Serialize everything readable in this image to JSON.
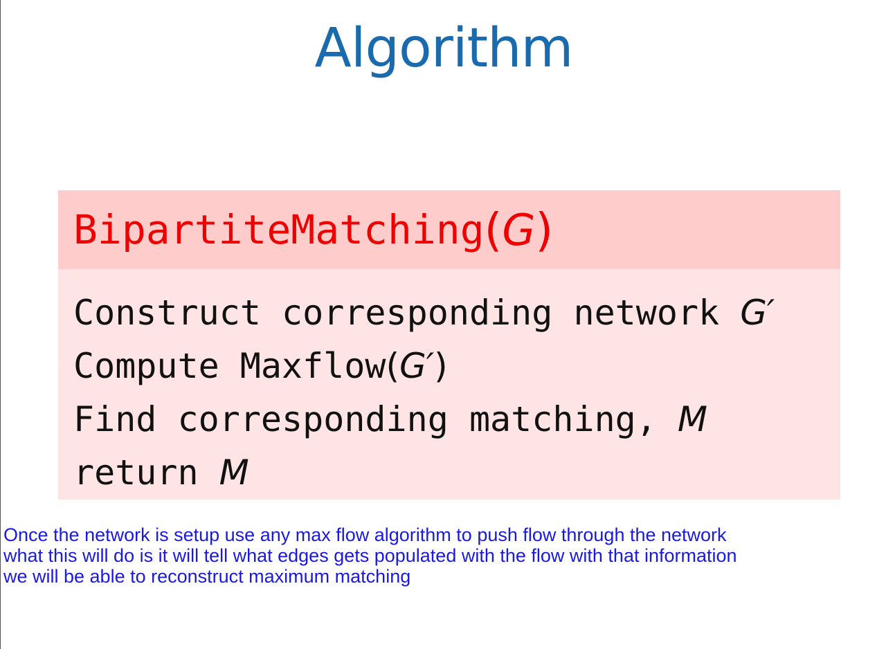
{
  "slide": {
    "title": "Algorithm"
  },
  "algorithm": {
    "header": {
      "name": "BipartiteMatching",
      "open_paren": "(",
      "argument": "G",
      "close_paren": ")"
    },
    "lines": [
      {
        "text": "Construct corresponding network",
        "math": "G′"
      },
      {
        "prefix": "Compute",
        "function": "Maxflow",
        "open_paren": "(",
        "math": "G′",
        "close_paren": ")"
      },
      {
        "text": "Find corresponding matching,",
        "math": "M"
      },
      {
        "text": "return",
        "math": "M"
      }
    ]
  },
  "notes": {
    "lines": [
      "Once the network is setup use any max flow algorithm to push flow through the network",
      "what this will do is it will tell what edges gets populated with the flow with that information",
      "we will be able to reconstruct maximum matching"
    ]
  },
  "colors": {
    "title": "#1a6bad",
    "header_bg": "#ffcccc",
    "header_text": "#ee0000",
    "body_bg": "#fee4e4",
    "notes_text": "#1a1adc"
  }
}
